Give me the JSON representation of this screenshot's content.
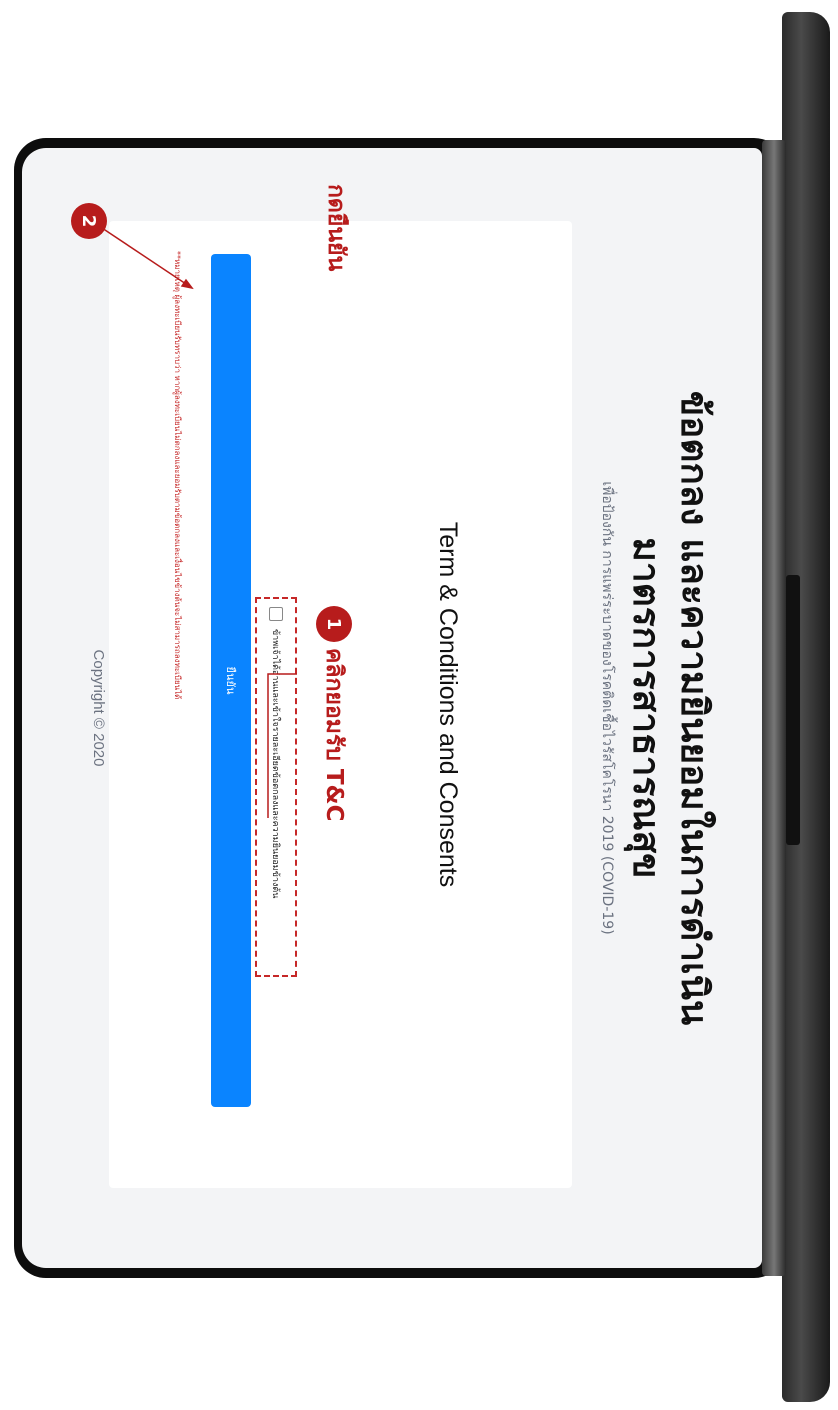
{
  "header": {
    "title_line1": "ข้อตกลง และความยินยอมในการดำเนิน",
    "title_line2": "มาตรการสาธารณสุข",
    "subtitle": "เพื่อป้องกัน การแพร่ระบาดของโรคติดเชื้อไวรัสโคโรนา 2019 (COVID-19)"
  },
  "card": {
    "title": "Term & Conditions and Consents",
    "consent_label": "ข้าพเจ้าได้อ่านและเข้าใจรายละเอียดข้อตกลงและความยินยอมข้างต้น",
    "confirm_label": "ยืนยัน",
    "note": "**หมายเหตุ ผู้ลงทะเบียนรับทราบว่า หากผู้ลงทะเบียนไม่ตกลงและยอมรับตามข้อตกลงและเงื่อนไขข้างต้นจะไม่สามารถลงทะเบียนได้"
  },
  "footer": {
    "copyright": "Copyright © 2020"
  },
  "annotations": {
    "step1_number": "1",
    "step1_text": "คลิกยอมรับ T&C",
    "step2_number": "2",
    "step2_text": "กดยืนยัน",
    "color": "#b71c1c"
  },
  "colors": {
    "accent": "#0a84ff",
    "screen_bg": "#f3f4f6",
    "card_bg": "#ffffff",
    "warning": "#c62828"
  }
}
